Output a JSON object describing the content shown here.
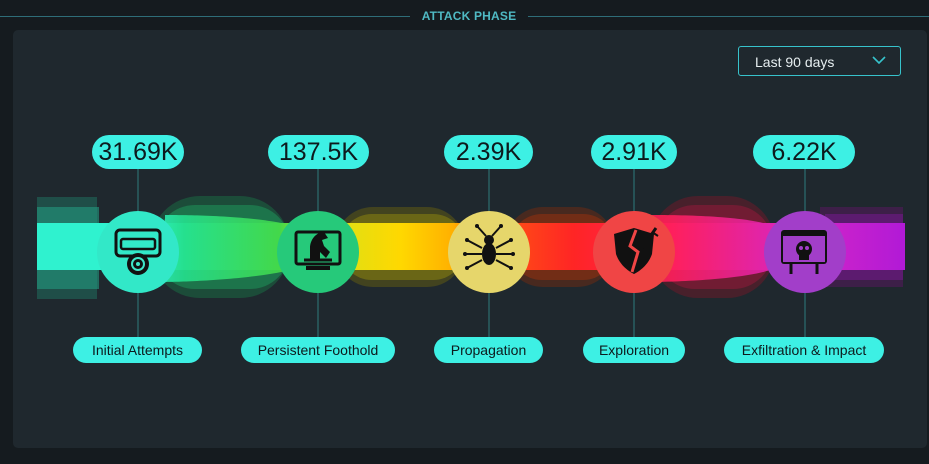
{
  "header": {
    "title": "ATTACK PHASE"
  },
  "range_select": {
    "value": "Last 90 days"
  },
  "phases": [
    {
      "name": "Initial Attempts",
      "count": "31.69K",
      "icon": "browser-gear-icon",
      "color": "#32e8c8"
    },
    {
      "name": "Persistent Foothold",
      "count": "137.5K",
      "icon": "trojan-horse-icon",
      "color": "#26c97a"
    },
    {
      "name": "Propagation",
      "count": "2.39K",
      "icon": "bug-circuit-icon",
      "color": "#e6d66b"
    },
    {
      "name": "Exploration",
      "count": "2.91K",
      "icon": "broken-shield-icon",
      "color": "#f04545"
    },
    {
      "name": "Exfiltration & Impact",
      "count": "6.22K",
      "icon": "skull-browser-icon",
      "color": "#a23ec9"
    }
  ]
}
